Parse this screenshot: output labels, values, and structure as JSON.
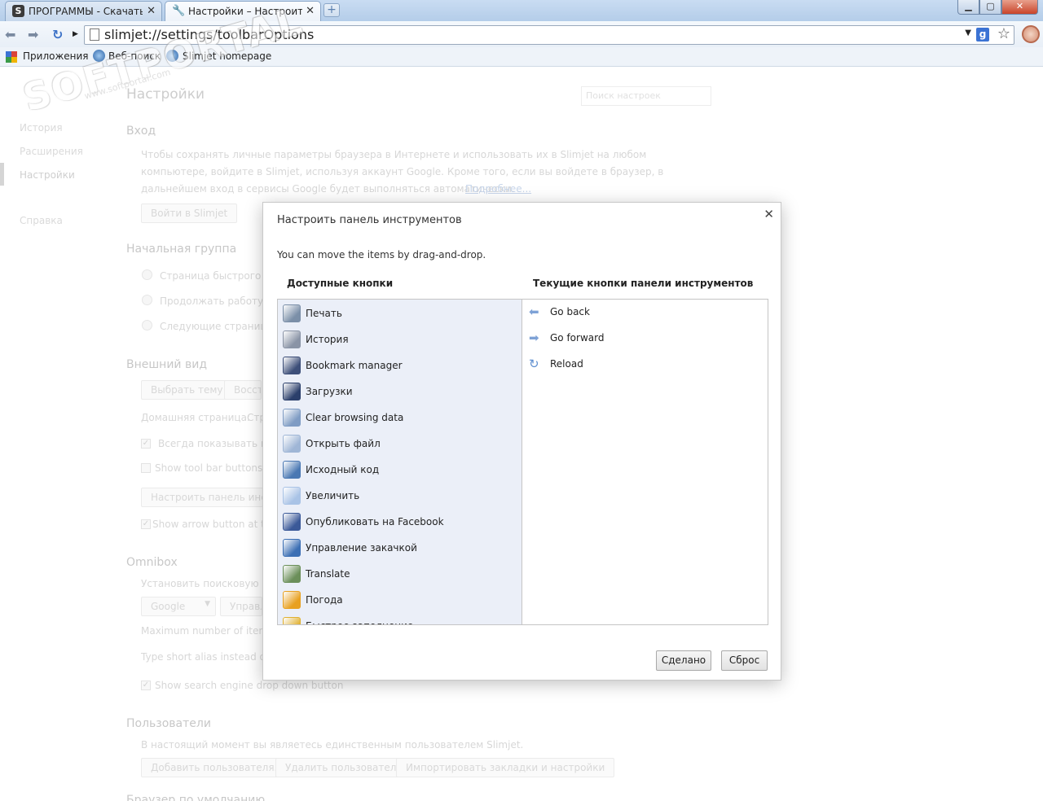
{
  "tabs": [
    {
      "title": "ПРОГРАММЫ - Скачать бесплатные программы",
      "favicon": "S"
    },
    {
      "title": "Настройки – Настроить панель инструментов"
    }
  ],
  "address": {
    "url": "slimjet://settings/toolbarOptions"
  },
  "bookmarks": [
    {
      "label": "Приложения"
    },
    {
      "label": "Веб-поиск"
    },
    {
      "label": "Slimjet homepage"
    }
  ],
  "watermark": {
    "big": "SOFTPORTAL",
    "small": "www.softportal.com"
  },
  "settings": {
    "title": "Настройки",
    "search_placeholder": "Поиск настроек",
    "nav": [
      "История",
      "Расширения",
      "Настройки",
      "Справка"
    ],
    "signin": {
      "header": "Вход",
      "text1": "Чтобы сохранять личные параметры браузера в Интернете и использовать их в Slimjet на любом",
      "text2": "компьютере, войдите в Slimjet, используя аккаунт Google. Кроме того, если вы войдете в браузер, в",
      "text3": "дальнейшем вход в сервисы Google будет выполняться автоматически.",
      "link": "Подробнее...",
      "button": "Войти в Slimjet"
    },
    "startup": {
      "header": "Начальная группа",
      "opt1": "Страница быстрого до",
      "opt2": "Продолжать работу с т",
      "opt3": "Следующие страницы"
    },
    "appearance": {
      "header": "Внешний вид",
      "theme_btn": "Выбрать тему",
      "restore_btn": "Восста",
      "homepage": "Домашняя страница:",
      "homepage_val": "Стр",
      "check1": "Всегда показывать пане",
      "check2": "Show tool bar buttons or",
      "toolbar_btn": "Настроить панель инстру",
      "check3": "Show arrow button at the"
    },
    "omnibox": {
      "header": "Omnibox",
      "text": "Установить поисковую сис",
      "engine": "Google",
      "manage_btn": "Управл",
      "max": "Maximum number of items",
      "alias": "Type short alias instead of lo",
      "check": "Show search engine drop down button"
    },
    "users": {
      "header": "Пользователи",
      "text": "В настоящий момент вы являетесь единственным пользователем Slimjet.",
      "btn1": "Добавить пользователя...",
      "btn2": "Удалить пользователя",
      "btn3": "Импортировать закладки и настройки"
    },
    "default_browser": {
      "header": "Браузер по умолчанию"
    }
  },
  "dialog": {
    "title": "Настроить панель инструментов",
    "hint": "You can move the items by drag-and-drop.",
    "available_header": "Доступные кнопки",
    "current_header": "Текущие кнопки панели инструментов",
    "available": [
      {
        "label": "Печать",
        "icon": "printer-icon",
        "color": "#7b8fa8"
      },
      {
        "label": "История",
        "icon": "clock-icon",
        "color": "#8a94a6"
      },
      {
        "label": "Bookmark manager",
        "icon": "bookmark-manager-icon",
        "color": "#3d4f79"
      },
      {
        "label": "Загрузки",
        "icon": "download-icon",
        "color": "#2b3f6b"
      },
      {
        "label": "Clear browsing data",
        "icon": "trash-icon",
        "color": "#7f9cc4"
      },
      {
        "label": "Открыть файл",
        "icon": "folder-icon",
        "color": "#9fb6d6"
      },
      {
        "label": "Исходный код",
        "icon": "html-icon",
        "color": "#4a78b3"
      },
      {
        "label": "Увеличить",
        "icon": "zoom-icon",
        "color": "#a9c3e6"
      },
      {
        "label": "Опубликовать на Facebook",
        "icon": "facebook-icon",
        "color": "#3b5998"
      },
      {
        "label": "Управление закачкой",
        "icon": "download-manager-icon",
        "color": "#3c6fb4"
      },
      {
        "label": "Translate",
        "icon": "translate-icon",
        "color": "#6b8f5a"
      },
      {
        "label": "Погода",
        "icon": "weather-icon",
        "color": "#e8a020"
      },
      {
        "label": "Быстрое заполнение",
        "icon": "autofill-icon",
        "color": "#e0b030"
      }
    ],
    "current": [
      {
        "label": "Go back",
        "icon": "arrow-left-icon",
        "color": "#7ea2d6"
      },
      {
        "label": "Go forward",
        "icon": "arrow-right-icon",
        "color": "#7ea2d6"
      },
      {
        "label": "Reload",
        "icon": "reload-icon",
        "color": "#5f8fd0"
      }
    ],
    "done_label": "Сделано",
    "reset_label": "Сброс"
  }
}
